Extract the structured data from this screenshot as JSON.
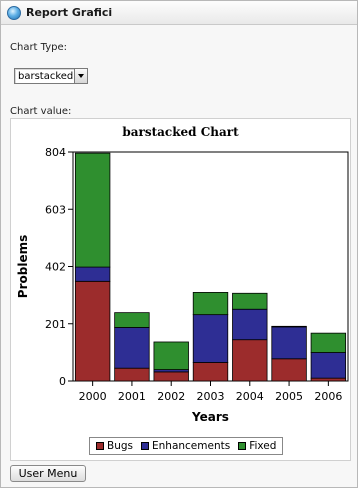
{
  "window": {
    "title": "Report Grafici"
  },
  "form": {
    "chart_type_label": "Chart Type:",
    "chart_type_value": "barstacked",
    "chart_value_label": "Chart value:"
  },
  "buttons": {
    "user_menu": "User Menu"
  },
  "colors": {
    "Bugs": "#9c2c2c",
    "Enhancements": "#2e2e94",
    "Fixed": "#2f8f2f"
  },
  "chart_data": {
    "type": "bar",
    "stacked": true,
    "title": "barstacked Chart",
    "xlabel": "Years",
    "ylabel": "Problems",
    "categories": [
      "2000",
      "2001",
      "2002",
      "2003",
      "2004",
      "2005",
      "2006"
    ],
    "series": [
      {
        "name": "Bugs",
        "values": [
          350,
          45,
          32,
          65,
          145,
          78,
          10
        ]
      },
      {
        "name": "Enhancements",
        "values": [
          50,
          143,
          8,
          168,
          107,
          112,
          90
        ]
      },
      {
        "name": "Fixed",
        "values": [
          400,
          52,
          97,
          78,
          56,
          2,
          68
        ]
      }
    ],
    "yticks": [
      0,
      201,
      402,
      603,
      804
    ],
    "ylim": [
      0,
      804
    ],
    "legend": "bottom",
    "grid": false
  }
}
